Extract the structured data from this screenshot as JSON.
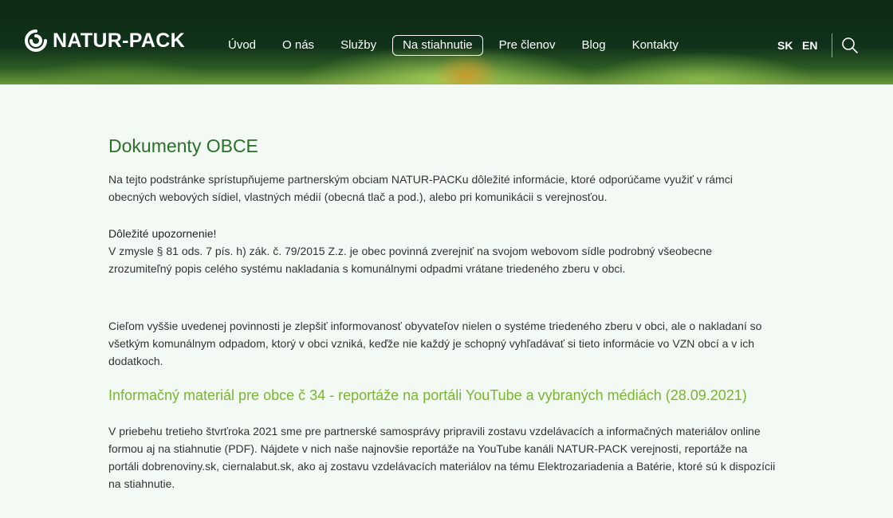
{
  "header": {
    "logo_text": "NATUR-PACK",
    "menu": [
      {
        "label": "Úvod"
      },
      {
        "label": "O nás"
      },
      {
        "label": "Služby"
      },
      {
        "label": "Na stiahnutie",
        "active": true
      },
      {
        "label": "Pre členov"
      },
      {
        "label": "Blog"
      },
      {
        "label": "Kontakty"
      }
    ],
    "lang_sk": "SK",
    "lang_en": "EN",
    "search_icon": "search-icon"
  },
  "main": {
    "title": "Dokumenty OBCE",
    "intro": "Na tejto podstránke sprístupňujeme partnerským obciam NATUR-PACKu dôležité informácie, ktoré odporúčame využiť v rámci obecných webových sídiel, vlastných médií (obecná tlač a pod.), alebo pri komunikácii s verejnosťou.",
    "warning_title": "Dôležité upozornenie!",
    "warning_text": "V zmysle § 81 ods. 7 pís. h) zák. č. 79/2015 Z.z. je obec  povinná zverejniť na svojom webovom sídle podrobný všeobecne zrozumiteľný popis celého systému nakladania s komunálnymi odpadmi vrátane triedeného zberu v obci.",
    "goal_text": "Cieľom vyššie uvedenej povinnosti je zlepšiť informovanosť obyvateľov nielen o systéme triedeného zberu v obci, ale o nakladaní so všetkým komunálnym odpadom, ktorý v obci vzniká, keďže nie každý je schopný vyhľadávať si tieto informácie vo VZN obcí a v ich dodatkoch.",
    "article_title": "Informačný materiál pre obce č 34 - reportáže na portáli YouTube a vybraných médiách (28.09.2021)",
    "article_text": "V priebehu tretieho štvrťroka 2021 sme pre partnerské samosprávy pripravili zostavu vzdelávacích a informačných materiálov online formou aj na stiahnutie (PDF). Nájdete v nich naše najnovšie reportáže na YouTube kanáli NATUR-PACK verejnosti, reportáže na portáli dobrenoviny.sk, ciernalabut.sk, ako aj zostavu vzdelávacích materiálov na tému Elektrozariadenia a Batérie, ktoré sú k dispozícii na stiahnutie."
  },
  "colors": {
    "heading": "#2a6f2a",
    "link": "#7ab532",
    "background": "#f3faf3"
  }
}
